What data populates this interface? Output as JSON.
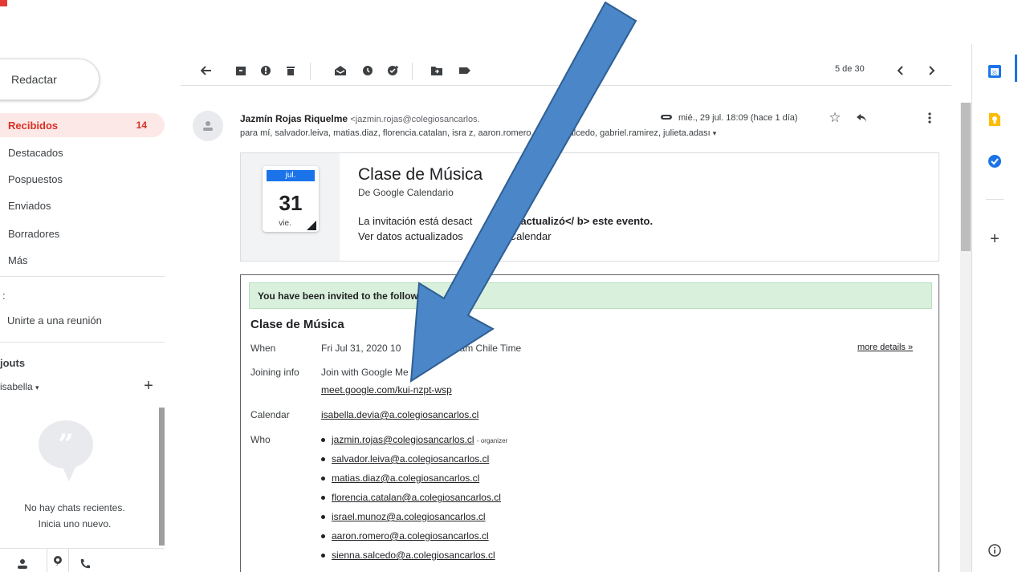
{
  "toolbar": {
    "back_icon": "arrow-left-icon",
    "icons": [
      "archive-icon",
      "report-spam-icon",
      "delete-icon",
      "mark-unread-icon",
      "snooze-icon",
      "add-task-icon",
      "move-to-icon",
      "labels-icon"
    ],
    "pager": "5 de 30",
    "prev_icon": "chevron-left-icon",
    "next_icon": "chevron-right-icon"
  },
  "nav": {
    "compose_label": "Redactar",
    "items": [
      {
        "label": "Recibidos",
        "count": "14"
      },
      {
        "label": "Destacados"
      },
      {
        "label": "Pospuestos"
      },
      {
        "label": "Enviados"
      },
      {
        "label": "Borradores"
      },
      {
        "label": "Más"
      }
    ],
    "meet_colon": ":",
    "join_meeting": "Unirte a una reunión",
    "hangouts_title": "jouts",
    "hangouts_user": "isabella",
    "hangouts_user_caret": "▾",
    "empty_chats_line1": "No hay chats recientes.",
    "empty_chats_line2": "Inicia uno nuevo."
  },
  "email": {
    "sender_name": "Jazmín Rojas Riquelme",
    "sender_email": "<jazmin.rojas@colegiosancarlos.",
    "recipients": "para mí, salvador.leiva, matias.diaz, florencia.catalan, isra            z, aaron.romero, sienna.salcedo, gabriel.ramirez, julieta.adası",
    "recipients_caret": "▾",
    "date": "mié., 29 jul. 18:09 (hace 1 día)"
  },
  "invite": {
    "month": "jul.",
    "day": "31",
    "dow": "vie.",
    "title": "Clase de Música",
    "source": "De Google Calendario",
    "notice_start": "La invitación está desact",
    "notice_mid": "a. Se ",
    "notice_bold": "actualizó</ b> este evento.",
    "view_start": "Ver datos actualizados",
    "view_end": "gle Calendar"
  },
  "details": {
    "banner": "You have been invited to the followin",
    "banner_end": "t.",
    "title": "Clase de Música",
    "when_label": "When",
    "when_value": "Fri Jul 31, 2020 10",
    "when_value_end": "11:30am Chile Time",
    "more_details": "more details »",
    "joining_label": "Joining info",
    "joining_value": "Join with Google Me",
    "meet_link": "meet.google.com/kui-nzpt-wsp",
    "calendar_label": "Calendar",
    "calendar_value": "isabella.devia@a.colegiosancarlos.cl",
    "who_label": "Who",
    "organizer_tag": "- organizer",
    "who": [
      "jazmin.rojas@colegiosancarlos.cl",
      "salvador.leiva@a.colegiosancarlos.cl",
      "matias.diaz@a.colegiosancarlos.cl",
      "florencia.catalan@a.colegiosancarlos.cl",
      "israel.munoz@a.colegiosancarlos.cl",
      "aaron.romero@a.colegiosancarlos.cl",
      "sienna.salcedo@a.colegiosancarlos.cl"
    ]
  },
  "side_panel": {
    "icons": [
      "calendar-app-icon",
      "keep-app-icon",
      "tasks-app-icon",
      "add-app-icon",
      "info-icon"
    ]
  },
  "colors": {
    "active_nav_bg": "#fce8e6",
    "active_nav_text": "#d93025",
    "banner_bg": "#d9f0dc",
    "calendar_blue": "#1a73e8",
    "arrow_fill": "#4a86c8",
    "arrow_stroke": "#2f5f93"
  }
}
